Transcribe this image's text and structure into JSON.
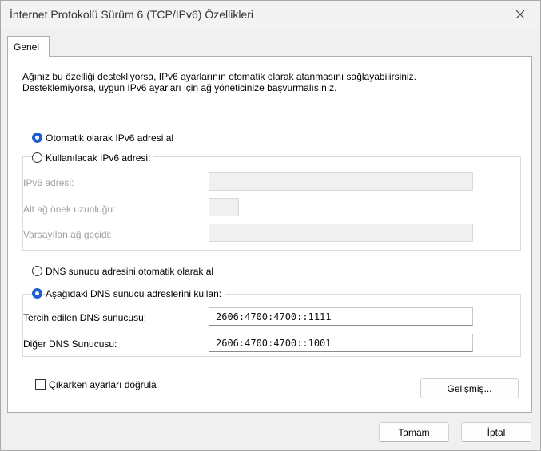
{
  "window": {
    "title": "İnternet Protokolü Sürüm 6 (TCP/IPv6) Özellikleri"
  },
  "tabs": [
    {
      "label": "Genel"
    }
  ],
  "description": {
    "line1": "Ağınız bu özelliği destekliyorsa, IPv6 ayarlarının otomatik olarak atanmasını sağlayabilirsiniz.",
    "line2": "Desteklemiyorsa, uygun IPv6 ayarları için ağ yöneticinize başvurmalısınız."
  },
  "ip_section": {
    "auto_label": "Otomatik olarak IPv6 adresi al",
    "auto_selected": true,
    "manual_label": "Kullanılacak IPv6 adresi:",
    "manual_selected": false,
    "fields": {
      "address_label": "IPv6 adresi:",
      "address_value": "",
      "prefix_label": "Alt ağ önek uzunluğu:",
      "prefix_value": "",
      "gateway_label": "Varsayılan ağ geçidi:",
      "gateway_value": ""
    }
  },
  "dns_section": {
    "auto_label": "DNS sunucu adresini otomatik olarak al",
    "auto_selected": false,
    "manual_label": "Aşağıdaki DNS sunucu adreslerini kullan:",
    "manual_selected": true,
    "preferred_label": "Tercih edilen DNS sunucusu:",
    "preferred_value": "2606:4700:4700::1111",
    "alternate_label": "Diğer DNS Sunucusu:",
    "alternate_value": "2606:4700:4700::1001"
  },
  "validate": {
    "label": "Çıkarken ayarları doğrula",
    "checked": false
  },
  "buttons": {
    "advanced": "Gelişmiş...",
    "ok": "Tamam",
    "cancel": "İptal"
  },
  "colors": {
    "accent": "#1e5fd0",
    "window_bg": "#f0f0f0",
    "panel_bg": "#ffffff",
    "disabled_text": "#a0a0a0"
  },
  "icons": {
    "close": "close-icon"
  }
}
